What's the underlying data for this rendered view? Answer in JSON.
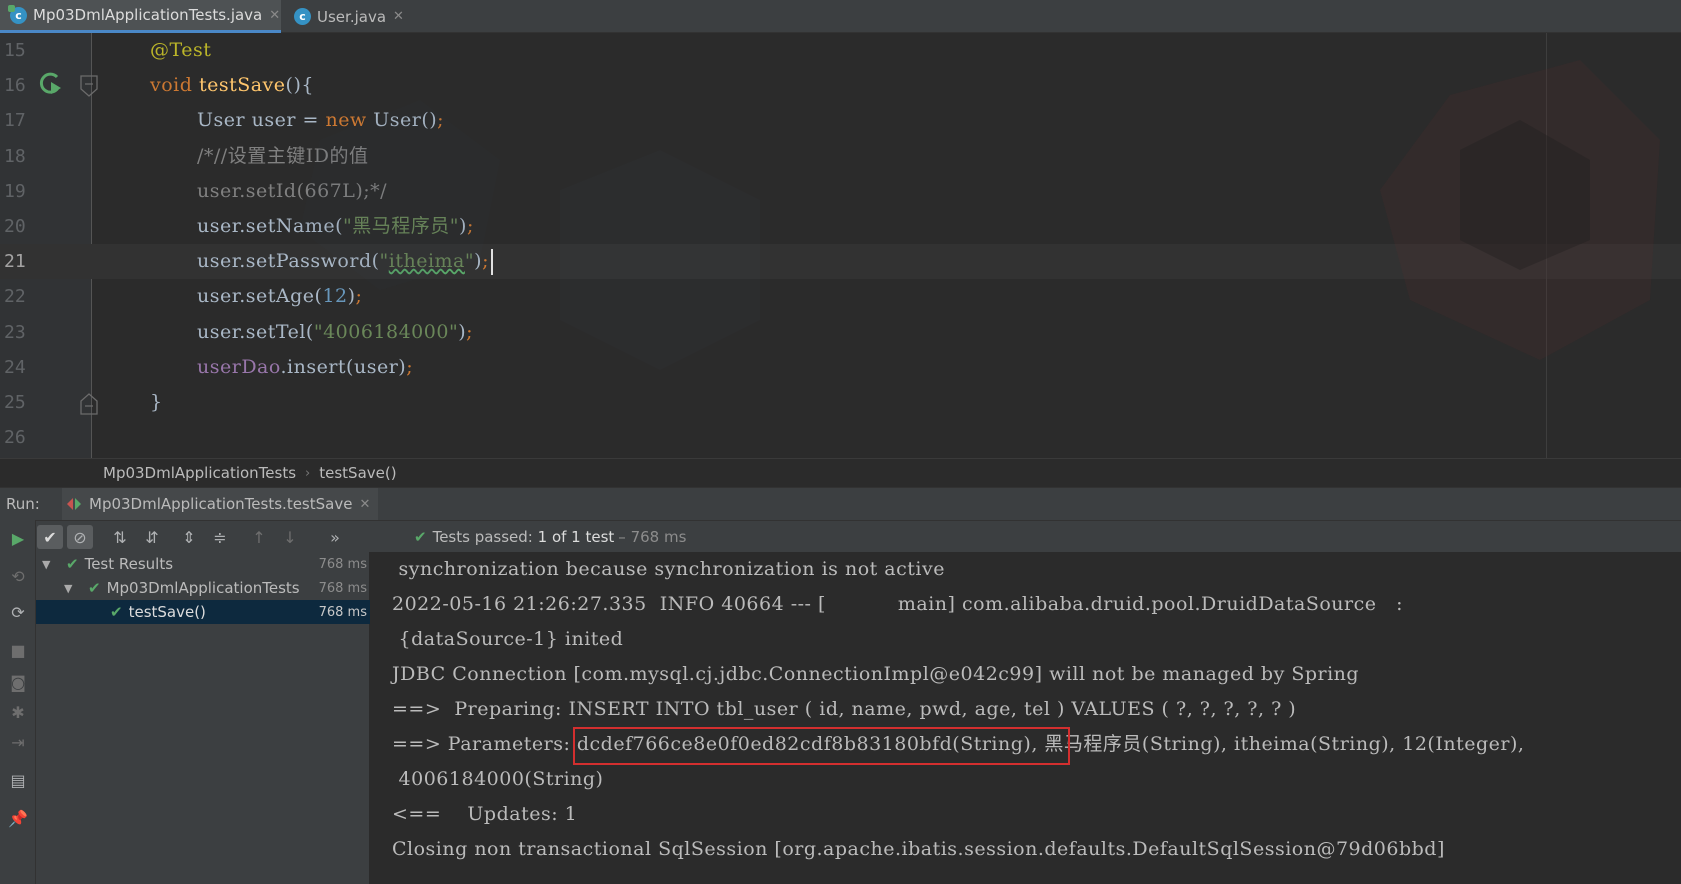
{
  "tabs": [
    {
      "label": "Mp03DmlApplicationTests.java",
      "icon": "java-test-class-icon",
      "active": true
    },
    {
      "label": "User.java",
      "icon": "java-class-icon",
      "active": false
    }
  ],
  "editor": {
    "lines": [
      {
        "no": "15",
        "parts": [
          {
            "t": "@Test",
            "c": "ann"
          }
        ]
      },
      {
        "no": "16",
        "parts": [
          {
            "t": "void ",
            "c": "kw"
          },
          {
            "t": "testSave",
            "c": "fn"
          },
          {
            "t": "(){",
            "c": ""
          }
        ]
      },
      {
        "no": "17",
        "parts": [
          {
            "t": "User user = ",
            "c": ""
          },
          {
            "t": "new ",
            "c": "kw"
          },
          {
            "t": "User()",
            "c": ""
          },
          {
            "t": ";",
            "c": "kw"
          }
        ]
      },
      {
        "no": "18",
        "parts": [
          {
            "t": "/*//设置主键ID的值",
            "c": "cmt"
          }
        ]
      },
      {
        "no": "19",
        "parts": [
          {
            "t": "user.setId(667L);*/",
            "c": "cmt"
          }
        ]
      },
      {
        "no": "20",
        "parts": [
          {
            "t": "user.setName(",
            "c": ""
          },
          {
            "t": "\"黑马程序员\"",
            "c": "str"
          },
          {
            "t": ")",
            "c": ""
          },
          {
            "t": ";",
            "c": "kw"
          }
        ]
      },
      {
        "no": "21",
        "parts": [
          {
            "t": "user.setPassword(",
            "c": ""
          },
          {
            "t": "\"",
            "c": "str"
          },
          {
            "t": "itheima",
            "c": "str typo"
          },
          {
            "t": "\"",
            "c": "str"
          },
          {
            "t": ")",
            "c": ""
          },
          {
            "t": ";",
            "c": "kw"
          }
        ]
      },
      {
        "no": "22",
        "parts": [
          {
            "t": "user.setAge(",
            "c": ""
          },
          {
            "t": "12",
            "c": "num"
          },
          {
            "t": ")",
            "c": ""
          },
          {
            "t": ";",
            "c": "kw"
          }
        ]
      },
      {
        "no": "23",
        "parts": [
          {
            "t": "user.setTel(",
            "c": ""
          },
          {
            "t": "\"4006184000\"",
            "c": "str"
          },
          {
            "t": ")",
            "c": ""
          },
          {
            "t": ";",
            "c": "kw"
          }
        ]
      },
      {
        "no": "24",
        "parts": [
          {
            "t": "userDao",
            "c": "fld"
          },
          {
            "t": ".insert(user)",
            "c": ""
          },
          {
            "t": ";",
            "c": "kw"
          }
        ]
      },
      {
        "no": "25",
        "parts": [
          {
            "t": "}",
            "c": ""
          }
        ]
      },
      {
        "no": "26",
        "parts": []
      }
    ],
    "current_line": "21"
  },
  "breadcrumb": {
    "class_name": "Mp03DmlApplicationTests",
    "method_name": "testSave()"
  },
  "run": {
    "label": "Run:",
    "tab_label": "Mp03DmlApplicationTests.testSave",
    "status": {
      "passed": "Tests passed:",
      "count": "1 of 1 test",
      "time": "– 768 ms"
    },
    "tree": [
      {
        "label": "Test Results",
        "duration": "768 ms",
        "level": 0
      },
      {
        "label": "Mp03DmlApplicationTests",
        "duration": "768 ms",
        "level": 1
      },
      {
        "label": "testSave()",
        "duration": "768 ms",
        "level": 2
      }
    ]
  },
  "console": {
    "lines": [
      " synchronization because synchronization is not active",
      "2022-05-16 21:26:27.335  INFO 40664 --- [           main] com.alibaba.druid.pool.DruidDataSource   :",
      " {dataSource-1} inited",
      "JDBC Connection [com.mysql.cj.jdbc.ConnectionImpl@e042c99] will not be managed by Spring",
      "==>  Preparing: INSERT INTO tbl_user ( id, name, pwd, age, tel ) VALUES ( ?, ?, ?, ?, ? )",
      "==> Parameters: dcdef766ce8e0f0ed82cdf8b83180bfd(String), 黑马程序员(String), itheima(String), 12(Integer),",
      " 4006184000(String)",
      "<==    Updates: 1",
      "Closing non transactional SqlSession [org.apache.ibatis.session.defaults.DefaultSqlSession@79d06bbd]"
    ]
  },
  "colors": {
    "accent": "#4a88c7",
    "passed": "#59a869",
    "highlight": "#d32f2f"
  }
}
